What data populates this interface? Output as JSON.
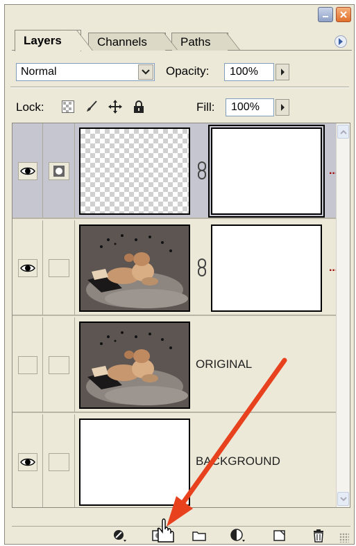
{
  "tabs": [
    {
      "label": "Layers",
      "active": true
    },
    {
      "label": "Channels",
      "active": false
    },
    {
      "label": "Paths",
      "active": false
    }
  ],
  "blend_mode": "Normal",
  "opacity": {
    "label": "Opacity:",
    "value": "100%"
  },
  "lock": {
    "label": "Lock:"
  },
  "fill": {
    "label": "Fill:",
    "value": "100%"
  },
  "layers": [
    {
      "name": "",
      "visible": true,
      "selected": true,
      "thumbnail": "transparent",
      "has_mask": true
    },
    {
      "name": "",
      "visible": true,
      "selected": false,
      "thumbnail": "dog-photo",
      "has_mask": true
    },
    {
      "name": "ORIGINAL",
      "visible": false,
      "selected": false,
      "thumbnail": "dog-photo",
      "has_mask": false
    },
    {
      "name": "BACKGROUND",
      "visible": true,
      "selected": false,
      "thumbnail": "white",
      "has_mask": false
    }
  ],
  "bottom_icons": [
    "link-layers-icon",
    "add-layer-mask-icon",
    "new-group-icon",
    "adjustment-layer-icon",
    "new-layer-icon",
    "trash-icon"
  ],
  "annotation": {
    "arrow_color": "#e8411e"
  }
}
